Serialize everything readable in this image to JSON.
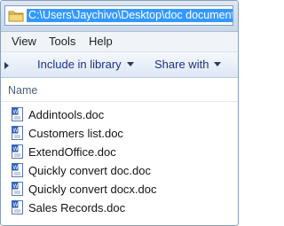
{
  "address": {
    "path": "C:\\Users\\Jaychivo\\Desktop\\doc documents"
  },
  "menu": [
    "View",
    "Tools",
    "Help"
  ],
  "commands": {
    "include_in_library": "Include in library",
    "share_with": "Share with"
  },
  "columns": {
    "name": "Name"
  },
  "files": [
    "Addintools.doc",
    "Customers list.doc",
    "ExtendOffice.doc",
    "Quickly convert doc.doc",
    "Quickly convert docx.doc",
    "Sales Records.doc"
  ],
  "icons": {
    "folder": "folder-icon",
    "document": "word-doc-icon"
  },
  "colors": {
    "selection": "#3399ff",
    "command_text": "#1e3287"
  }
}
